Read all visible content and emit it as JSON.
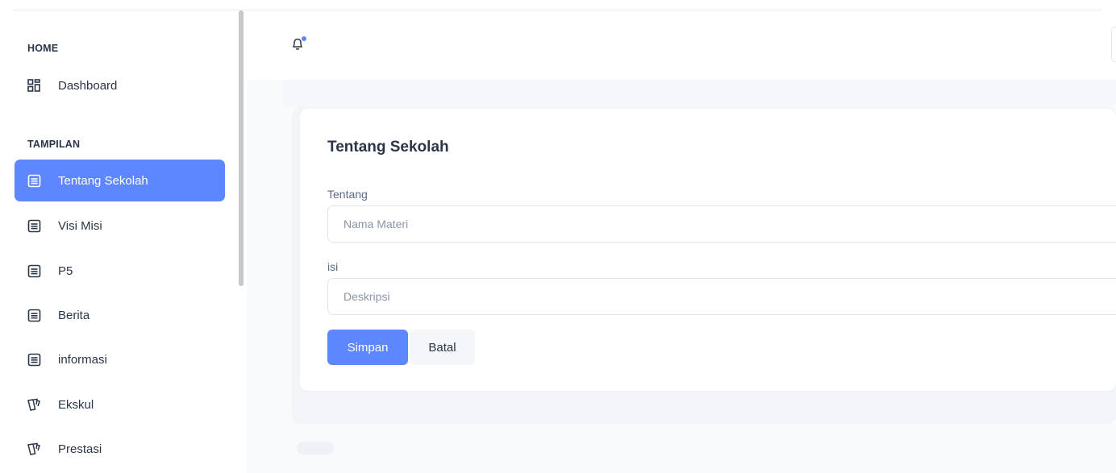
{
  "sidebar": {
    "sections": [
      {
        "title": "HOME"
      },
      {
        "title": "TAMPILAN"
      }
    ],
    "items": [
      {
        "label": "Dashboard",
        "icon": "dashboard-icon"
      },
      {
        "label": "Tentang Sekolah",
        "icon": "document-icon",
        "active": true
      },
      {
        "label": "Visi Misi",
        "icon": "document-icon"
      },
      {
        "label": "P5",
        "icon": "document-icon"
      },
      {
        "label": "Berita",
        "icon": "document-icon"
      },
      {
        "label": "informasi",
        "icon": "document-icon"
      },
      {
        "label": "Ekskul",
        "icon": "cards-icon"
      },
      {
        "label": "Prestasi",
        "icon": "cards-icon"
      }
    ]
  },
  "header": {
    "notification_icon": "bell-icon",
    "has_unread": true
  },
  "form": {
    "title": "Tentang Sekolah",
    "fields": [
      {
        "label": "Tentang",
        "placeholder": "Nama Materi",
        "value": ""
      },
      {
        "label": "isi",
        "placeholder": "Deskripsi",
        "value": ""
      }
    ],
    "save_label": "Simpan",
    "cancel_label": "Batal"
  },
  "colors": {
    "accent": "#5d87ff",
    "text": "#2a3547",
    "muted": "#5a6a85",
    "border": "#dfe5ef"
  }
}
